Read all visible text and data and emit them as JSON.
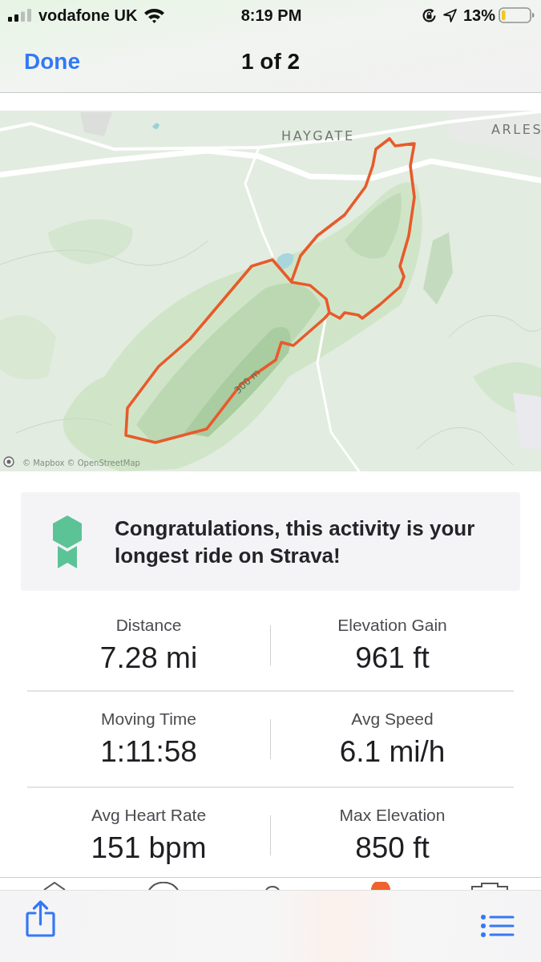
{
  "status_bar": {
    "carrier": "vodafone UK",
    "time": "8:19 PM",
    "battery": "13%"
  },
  "nav": {
    "done": "Done",
    "title": "1 of 2"
  },
  "map": {
    "places": [
      {
        "label": "HAYGATE"
      },
      {
        "label": "ARLES"
      }
    ],
    "contour": "300 m",
    "attribution": "© Mapbox © OpenStreetMap"
  },
  "achievement": {
    "text": "Congratulations, this activity is your longest ride on Strava!"
  },
  "stats": [
    {
      "label": "Distance",
      "value": "7.28 mi"
    },
    {
      "label": "Elevation Gain",
      "value": "961 ft"
    },
    {
      "label": "Moving Time",
      "value": "1:11:58"
    },
    {
      "label": "Avg Speed",
      "value": "6.1 mi/h"
    },
    {
      "label": "Avg Heart Rate",
      "value": "151 bpm"
    },
    {
      "label": "Max Elevation",
      "value": "850 ft"
    }
  ]
}
